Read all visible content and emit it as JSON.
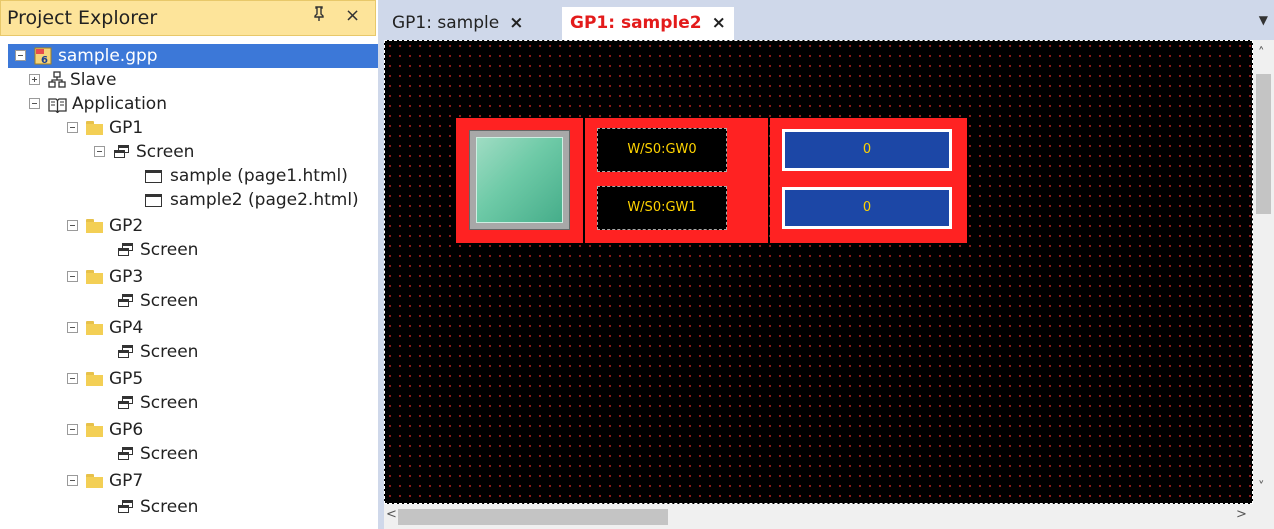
{
  "explorer": {
    "title": "Project Explorer",
    "pin_icon": "ᵖ",
    "close_icon": "×",
    "tree": {
      "project": "sample.gpp",
      "slave": "Slave",
      "application": "Application",
      "gp1": "GP1",
      "gp1_screen": "Screen",
      "page1": "sample (page1.html)",
      "page2": "sample2 (page2.html)",
      "gp2": "GP2",
      "gp2_screen": "Screen",
      "gp3": "GP3",
      "gp3_screen": "Screen",
      "gp4": "GP4",
      "gp4_screen": "Screen",
      "gp5": "GP5",
      "gp5_screen": "Screen",
      "gp6": "GP6",
      "gp6_screen": "Screen",
      "gp7": "GP7",
      "gp7_screen": "Screen"
    }
  },
  "tabs": {
    "tab1": "GP1: sample",
    "tab2": "GP1: sample2",
    "close": "×",
    "dropdown": "▼"
  },
  "canvas": {
    "label1": "W/S0:GW0",
    "label2": "W/S0:GW1",
    "value1": "0",
    "value2": "0"
  },
  "colors": {
    "active_tab_text": "#e31b1b",
    "group_frame": "#ff2222",
    "numeric_box": "#1c47a6",
    "label_text": "#ffd400",
    "selection": "#3c78d8"
  }
}
